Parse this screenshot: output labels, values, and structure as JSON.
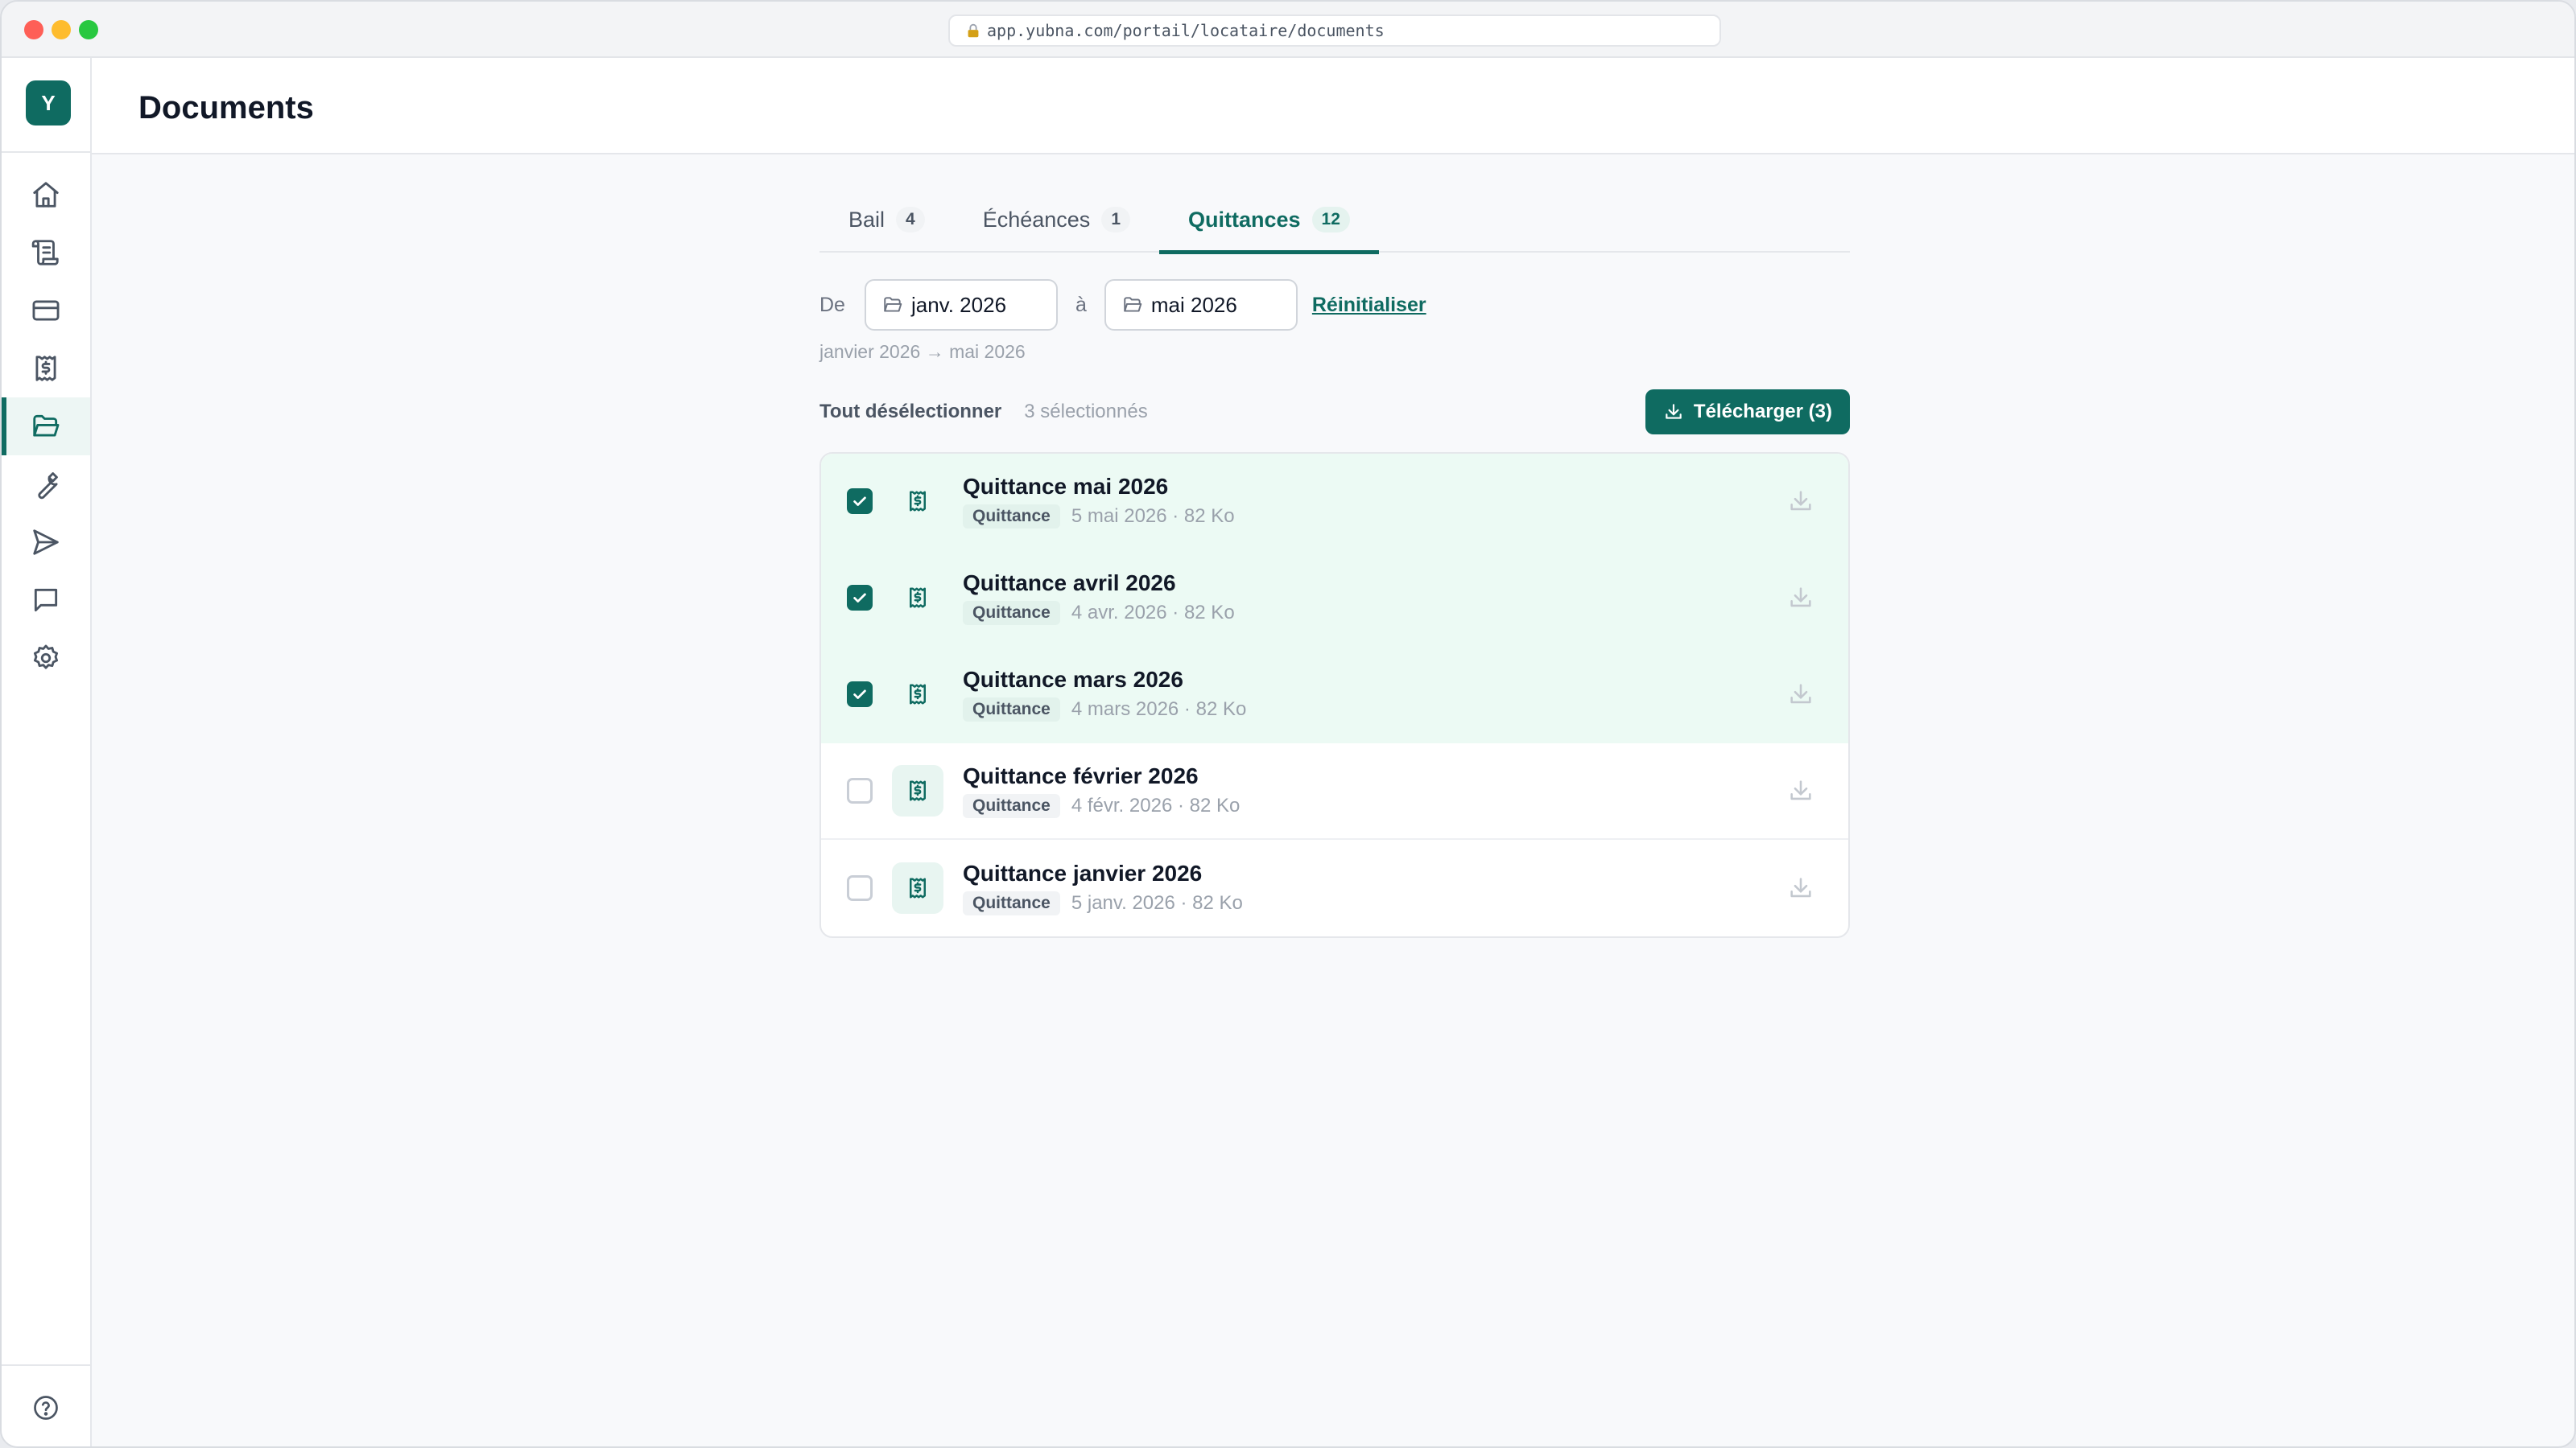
{
  "browser": {
    "url": "app.yubna.com/portail/locataire/documents"
  },
  "sidebar": {
    "logo": "Y",
    "items": [
      {
        "name": "home",
        "icon": "home-icon"
      },
      {
        "name": "lease",
        "icon": "scroll-icon"
      },
      {
        "name": "payments",
        "icon": "credit-card-icon"
      },
      {
        "name": "receipts",
        "icon": "receipt-icon"
      },
      {
        "name": "documents",
        "icon": "folder-open-icon",
        "active": true
      },
      {
        "name": "maintenance",
        "icon": "wrench-icon"
      },
      {
        "name": "send",
        "icon": "send-icon"
      },
      {
        "name": "messages",
        "icon": "message-icon"
      },
      {
        "name": "settings",
        "icon": "gear-icon"
      }
    ],
    "help_icon": "help-circle-icon"
  },
  "header": {
    "title": "Documents"
  },
  "tabs": [
    {
      "label": "Bail",
      "count": "4",
      "active": false
    },
    {
      "label": "Échéances",
      "count": "1",
      "active": false
    },
    {
      "label": "Quittances",
      "count": "12",
      "active": true
    }
  ],
  "filters": {
    "from_label": "De",
    "from_value": "janv. 2026",
    "to_label": "à",
    "to_value": "mai 2026",
    "reset_label": "Réinitialiser",
    "range_summary": "janvier 2026 → mai 2026"
  },
  "selection": {
    "deselect_label": "Tout désélectionner",
    "count_label": "3 sélectionnés",
    "download_label": "Télécharger (3)"
  },
  "documents": [
    {
      "title": "Quittance mai 2026",
      "tag": "Quittance",
      "meta": "5 mai 2026 · 82 Ko",
      "selected": true
    },
    {
      "title": "Quittance avril 2026",
      "tag": "Quittance",
      "meta": "4 avr. 2026 · 82 Ko",
      "selected": true
    },
    {
      "title": "Quittance mars 2026",
      "tag": "Quittance",
      "meta": "4 mars 2026 · 82 Ko",
      "selected": true
    },
    {
      "title": "Quittance février 2026",
      "tag": "Quittance",
      "meta": "4 févr. 2026 · 82 Ko",
      "selected": false
    },
    {
      "title": "Quittance janvier 2026",
      "tag": "Quittance",
      "meta": "5 janv. 2026 · 82 Ko",
      "selected": false
    }
  ],
  "colors": {
    "accent": "#0f6b61",
    "selected_row": "#ecfaf4",
    "icon_gray": "#4b5563"
  }
}
